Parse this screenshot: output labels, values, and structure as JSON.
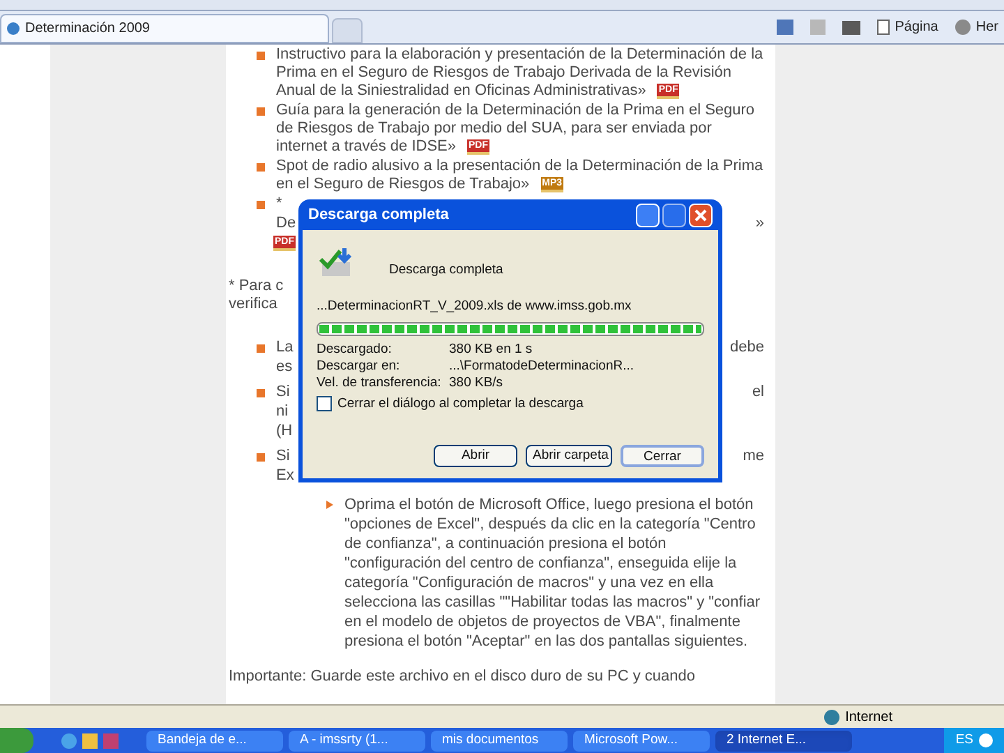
{
  "tab": {
    "title": "Determinación 2009"
  },
  "toolbar": [
    {
      "label": "Página",
      "kind": "page"
    },
    {
      "label": "Her",
      "kind": "tools"
    }
  ],
  "items": [
    {
      "text": "Instructivo para la elaboración y presentación de la Determinación de la Prima en el Seguro de Riesgos de Trabajo Derivada de la Revisión Anual de la Siniestralidad en Oficinas Administrativas»",
      "file_type": "PDF"
    },
    {
      "text": "Guía para la generación de la Determinación de la Prima en el Seguro de Riesgos de Trabajo por medio del SUA, para ser enviada por internet a través de IDSE»",
      "file_type": "PDF"
    },
    {
      "text": "Spot de radio alusivo a la presentación de la Determinación de la Prima en el Seguro de Riesgos de Trabajo»",
      "file_type": "MP3"
    }
  ],
  "covered_item": {
    "lines": [
      {
        "left": "*"
      },
      {
        "left": "De",
        "right": "»"
      }
    ],
    "file_type": "PDF"
  },
  "covered_note": [
    "* Para c",
    "verifica"
  ],
  "covered_bullets": [
    {
      "lines": [
        {
          "left": "La",
          "right": "debe"
        },
        {
          "left": "es"
        }
      ]
    },
    {
      "lines": [
        {
          "left": "Si",
          "right": "el"
        },
        {
          "left": "ni"
        },
        {
          "left": "(H"
        }
      ]
    },
    {
      "lines": [
        {
          "left": "Si",
          "right": "me"
        },
        {
          "left": "Ex"
        }
      ]
    }
  ],
  "sub_item": "Oprima el botón de Microsoft Office, luego presiona el botón \"opciones de Excel\", después da clic en la categoría \"Centro de confianza\", a continuación presiona el botón \"configuración del centro de confianza\", enseguida elije la categoría \"Configuración de macros\" y una vez en ella selecciona las casillas \"\"Habilitar todas las macros\" y \"confiar en el modelo de objetos de proyectos de VBA\", finalmente presiona el botón \"Aceptar\" en las dos pantallas siguientes.",
  "footer_text": "Importante: Guarde este archivo en el disco duro de su PC y cuando",
  "dialog": {
    "title": "Descarga completa",
    "heading": "Descarga completa",
    "file": "...DeterminacionRT_V_2009.xls de www.imss.gob.mx",
    "level": 1,
    "rows": [
      {
        "label": "Descargado:",
        "value": "380 KB en 1 s"
      },
      {
        "label": "Descargar en:",
        "value": "...\\FormatodeDeterminacionR..."
      },
      {
        "label": "Vel. de transferencia:",
        "value": "380 KB/s"
      }
    ],
    "close_when_done": {
      "label": "Cerrar el diálogo al completar la descarga",
      "checked": false
    },
    "buttons": [
      {
        "label": "Abrir",
        "selected": false
      },
      {
        "label": "Abrir carpeta",
        "selected": false
      },
      {
        "label": "Cerrar",
        "selected": true
      }
    ]
  },
  "status": {
    "zone": "Internet"
  },
  "taskbar": {
    "tasks": [
      {
        "label": "Bandeja de e...",
        "selected": false
      },
      {
        "label": "A - imssrty (1...",
        "selected": false
      },
      {
        "label": "mis documentos",
        "selected": false
      },
      {
        "label": "Microsoft Pow...",
        "selected": false
      },
      {
        "label": "2 Internet E...",
        "selected": true
      }
    ],
    "language": "ES"
  }
}
